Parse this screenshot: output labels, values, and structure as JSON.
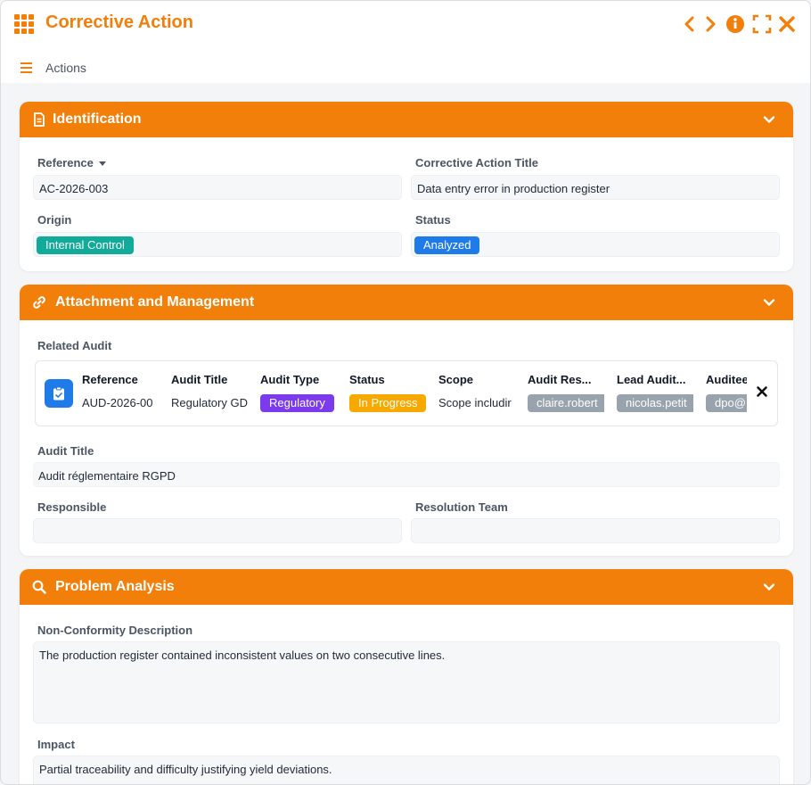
{
  "window": {
    "title": "Corrective Action",
    "icons": {
      "app": "apps-grid-icon",
      "prev": "chevron-left-icon",
      "next": "chevron-right-icon",
      "info": "info-icon",
      "expand": "fullscreen-icon",
      "close": "close-icon"
    },
    "accent": "#f17f0a"
  },
  "toolbar": {
    "actions_label": "Actions",
    "menu_icon": "hamburger-icon"
  },
  "identification": {
    "title": "Identification",
    "icon": "document-icon",
    "reference_label": "Reference",
    "reference_value": "AC-2026-003",
    "title_label": "Corrective Action Title",
    "title_value": "Data entry error in production register",
    "origin_label": "Origin",
    "origin_value": "Internal Control",
    "origin_color": "#12ab9a",
    "status_label": "Status",
    "status_value": "Analyzed",
    "status_color": "#1e7be8"
  },
  "attachment": {
    "title": "Attachment and Management",
    "icon": "link-icon",
    "related_audit_label": "Related Audit",
    "audit_card": {
      "icon": "clipboard-check-icon",
      "columns": [
        {
          "header": "Reference",
          "value": "AUD-2026-00",
          "kind": "text"
        },
        {
          "header": "Audit Title",
          "value": "Regulatory GD",
          "kind": "text"
        },
        {
          "header": "Audit Type",
          "value": "Regulatory",
          "kind": "pill",
          "color": "#7c3aed"
        },
        {
          "header": "Status",
          "value": "In Progress",
          "kind": "pill",
          "color": "#f7a900"
        },
        {
          "header": "Scope",
          "value": "Scope includir",
          "kind": "text"
        },
        {
          "header": "Audit Res...",
          "value": "claire.robert",
          "kind": "pill",
          "color": "#98a3ae"
        },
        {
          "header": "Lead Audit...",
          "value": "nicolas.petit",
          "kind": "pill",
          "color": "#98a3ae"
        },
        {
          "header": "Auditee",
          "value": "dpo@",
          "kind": "pill",
          "color": "#98a3ae"
        }
      ],
      "remove_icon": "close-icon"
    },
    "audit_title_label": "Audit Title",
    "audit_title_value": "Audit réglementaire RGPD",
    "responsible_label": "Responsible",
    "responsible_value": "",
    "resolution_team_label": "Resolution Team",
    "resolution_team_value": ""
  },
  "problem": {
    "title": "Problem Analysis",
    "icon": "search-icon",
    "nc_label": "Non-Conformity Description",
    "nc_value": "The production register contained inconsistent values on two consecutive lines.",
    "impact_label": "Impact",
    "impact_value": "Partial traceability and difficulty justifying yield deviations."
  }
}
